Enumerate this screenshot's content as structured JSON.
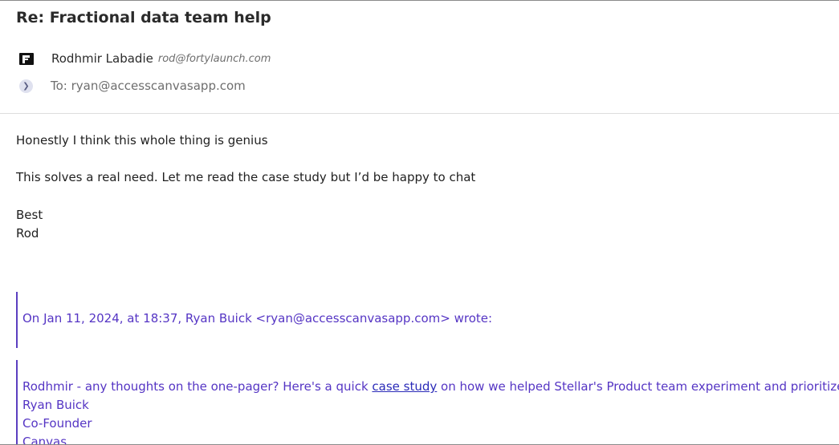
{
  "email": {
    "subject": "Re: Fractional data team help",
    "sender": {
      "name": "Rodhmir Labadie",
      "email": "rod@fortylaunch.com",
      "logo_icon": "fortylaunch-logo-icon"
    },
    "recipients": {
      "expand_icon": "chevron-right-icon",
      "to_text": "To: ryan@accesscanvasapp.com"
    },
    "body": {
      "line1": "Honestly I think this whole thing is genius",
      "line2": "This solves a real need. Let me read the case study but I’d be happy to chat",
      "signoff": "Best",
      "signature": "Rod"
    },
    "quoted_header": "On Jan 11, 2024, at 18:37, Ryan Buick <ryan@accesscanvasapp.com> wrote:",
    "quoted_message": {
      "text_before_link": "Rodhmir - any thoughts on the one-pager? Here's a quick ",
      "link_text": "case study",
      "text_after_link": " on how we helped Stellar's Product team experiment and prioritize faster.",
      "sig_name": "Ryan Buick",
      "sig_title": "Co-Founder",
      "sig_company": "Canvas"
    }
  },
  "colors": {
    "quote_text": "#5535c4",
    "quote_border": "#5b3fc0",
    "link": "#2a2ab8"
  }
}
